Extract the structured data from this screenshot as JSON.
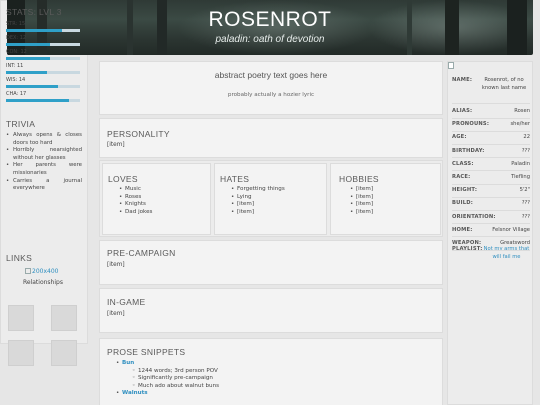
{
  "banner": {
    "title": "ROSENROT",
    "subtitle": "paladin: oath of devotion"
  },
  "stats": {
    "heading": "STATS: LVL 3",
    "items": [
      {
        "label": "STR: 15",
        "value": 15
      },
      {
        "label": "DEX: 12",
        "value": 12
      },
      {
        "label": "CON: 12",
        "value": 12
      },
      {
        "label": "INT: 11",
        "value": 11
      },
      {
        "label": "WIS: 14",
        "value": 14
      },
      {
        "label": "CHA: 17",
        "value": 17
      }
    ],
    "bar_color": "#2fa0c8"
  },
  "trivia": {
    "heading": "TRIVIA",
    "items": [
      "Always opens & closes doors too hard",
      "Horribly nearsighted without her glasses",
      "Her parents were missionaries",
      "Carries a journal everywhere"
    ]
  },
  "links": {
    "heading": "LINKS",
    "image_alt": "200x400",
    "relationships": "Relationships"
  },
  "poetry": {
    "title": "abstract poetry text goes here",
    "subtitle": "probably actually a hozier lyric"
  },
  "personality": {
    "heading": "PERSONALITY",
    "item": "[item]"
  },
  "loves": {
    "heading": "LOVES",
    "items": [
      "Music",
      "Roses",
      "Knights",
      "Dad jokes"
    ]
  },
  "hates": {
    "heading": "HATES",
    "items": [
      "Forgetting things",
      "Lying",
      "[item]",
      "[item]"
    ]
  },
  "hobbies": {
    "heading": "HOBBIES",
    "items": [
      "[item]",
      "[item]",
      "[item]",
      "[item]"
    ]
  },
  "precampaign": {
    "heading": "PRE-CAMPAIGN",
    "item": "[item]"
  },
  "ingame": {
    "heading": "IN-GAME",
    "item": "[item]"
  },
  "prose": {
    "heading": "PROSE SNIPPETS",
    "entries": [
      {
        "title": "Bun",
        "details": [
          "1244 words; 3rd person POV",
          "Significantly pre-campaign",
          "Much ado about walnut buns"
        ]
      },
      {
        "title": "Walnuts",
        "details": []
      }
    ]
  },
  "profile": {
    "name_label": "NAME:",
    "name_value": "Rosenrot, of no known last name",
    "rows": [
      {
        "k": "ALIAS:",
        "v": "Rosen"
      },
      {
        "k": "PRONOUNS:",
        "v": "she/her"
      },
      {
        "k": "AGE:",
        "v": "22"
      },
      {
        "k": "BIRTHDAY:",
        "v": "???"
      },
      {
        "k": "CLASS:",
        "v": "Paladin"
      },
      {
        "k": "RACE:",
        "v": "Tiefling"
      },
      {
        "k": "HEIGHT:",
        "v": "5'2\""
      },
      {
        "k": "BUILD:",
        "v": "???"
      },
      {
        "k": "ORIENTATION:",
        "v": "???"
      },
      {
        "k": "HOME:",
        "v": "Felsnor Village"
      },
      {
        "k": "WEAPON:",
        "v": "Greatsword"
      }
    ],
    "playlist_label": "PLAYLIST:",
    "playlist_value": "Not my arms that will fail me"
  }
}
